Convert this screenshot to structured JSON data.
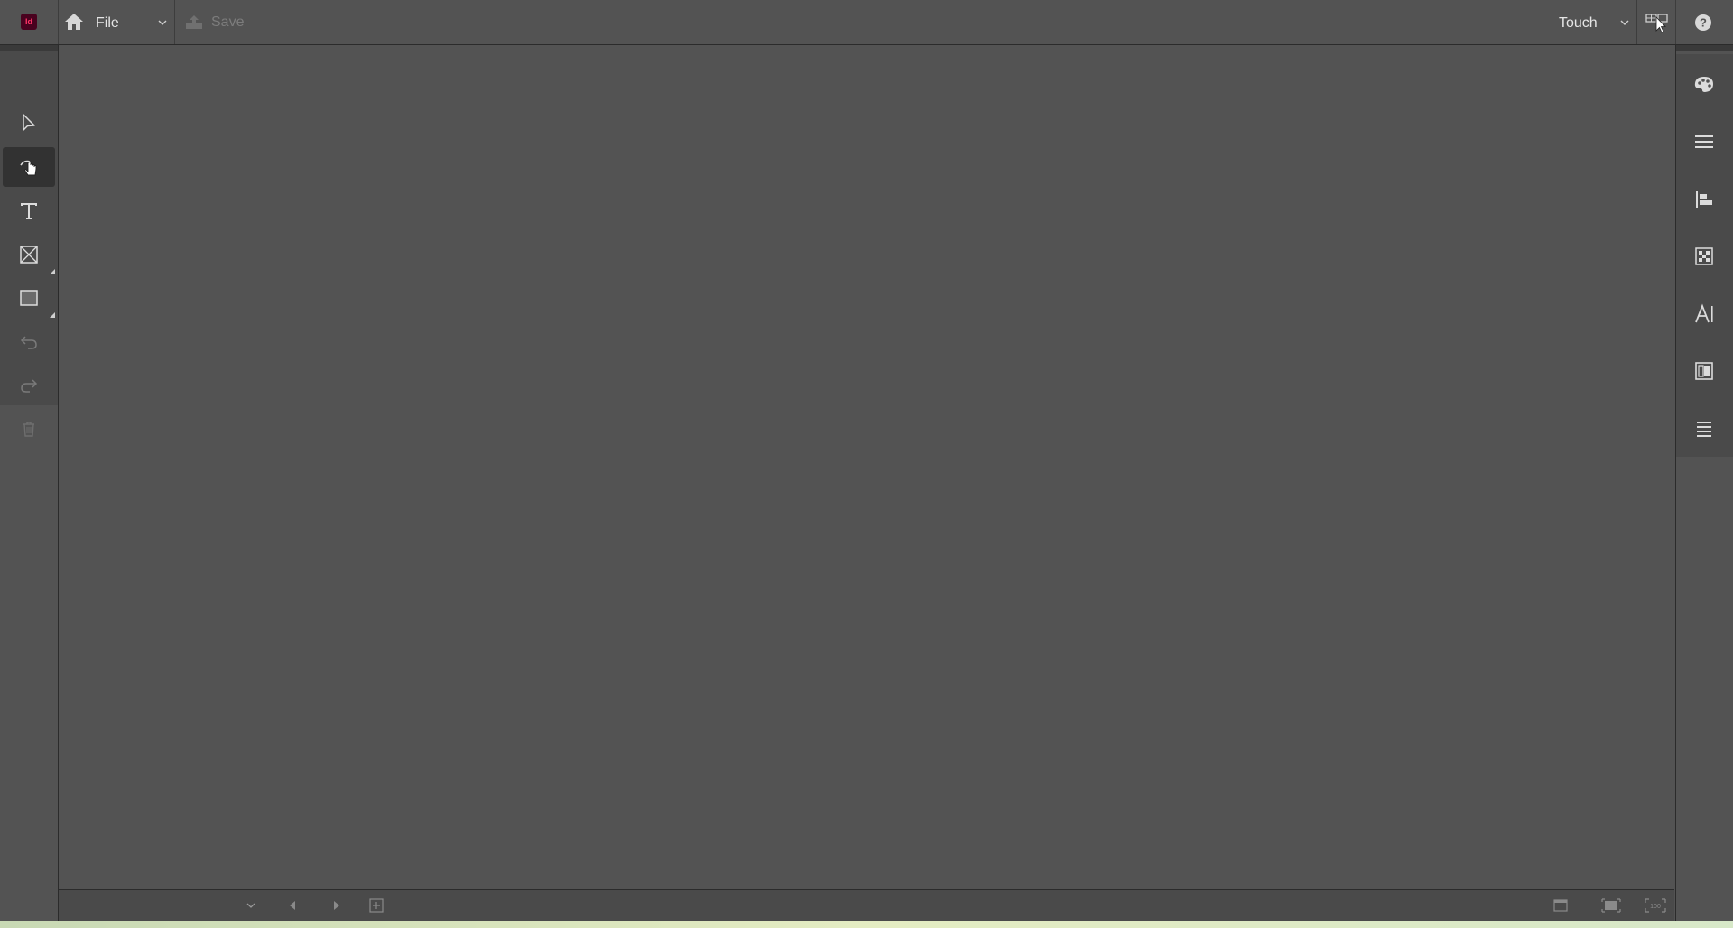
{
  "app": {
    "logo_text": "Id",
    "accent": "#ff3366"
  },
  "toolbar": {
    "file_label": "File",
    "save_label": "Save",
    "workspace_label": "Touch"
  },
  "tools": [
    {
      "name": "selection-tool",
      "icon": "arrow-pointer-icon"
    },
    {
      "name": "hand-tool",
      "icon": "hand-icon",
      "active": true
    },
    {
      "name": "type-tool",
      "icon": "type-T-icon"
    },
    {
      "name": "rectangle-frame-tool",
      "icon": "frame-x-icon"
    },
    {
      "name": "rectangle-tool",
      "icon": "rectangle-icon"
    },
    {
      "name": "undo-tool",
      "icon": "undo-icon",
      "disabled": true
    },
    {
      "name": "redo-tool",
      "icon": "redo-icon",
      "disabled": true
    },
    {
      "name": "delete-tool",
      "icon": "trash-icon",
      "disabled": true
    }
  ],
  "right_panel": [
    {
      "name": "swatches-panel-button",
      "icon": "palette-icon"
    },
    {
      "name": "stroke-panel-button",
      "icon": "stroke-lines-icon"
    },
    {
      "name": "align-panel-button",
      "icon": "align-left-icon"
    },
    {
      "name": "effects-panel-button",
      "icon": "checker-icon"
    },
    {
      "name": "character-panel-button",
      "icon": "character-A-icon"
    },
    {
      "name": "pages-panel-button",
      "icon": "pages-icon"
    },
    {
      "name": "paragraph-panel-button",
      "icon": "paragraph-lines-icon"
    }
  ]
}
